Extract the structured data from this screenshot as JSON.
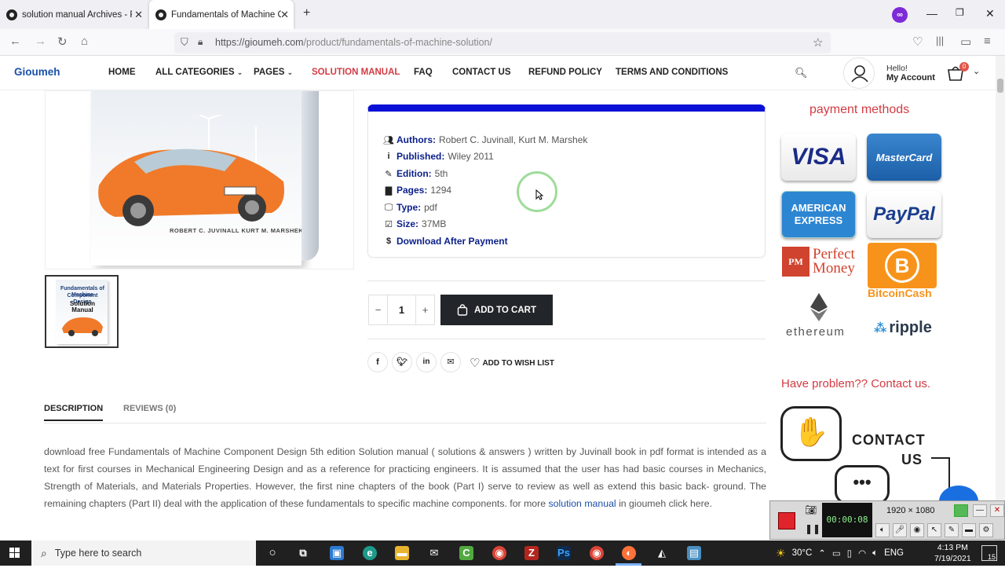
{
  "browser": {
    "tabs": [
      {
        "label": "solution manual Archives - Page",
        "active": false
      },
      {
        "label": "Fundamentals of Machine Comp",
        "active": true
      }
    ],
    "url_host": "https://gioumeh.com",
    "url_path": "/product/fundamentals-of-machine-solution/"
  },
  "site": {
    "logo": "Gioumeh",
    "menu": [
      "HOME",
      "ALL CATEGORIES",
      "PAGES",
      "SOLUTION MANUAL",
      "FAQ",
      "CONTACT US",
      "REFUND POLICY",
      "TERMS AND CONDITIONS"
    ],
    "active_menu": "SOLUTION MANUAL",
    "account_hello": "Hello!",
    "account_label": "My Account",
    "cart_count": "0"
  },
  "product": {
    "cover_authors": "ROBERT C. JUVINALL   KURT M. MARSHEK",
    "thumb_title_1": "Fundamentals of Machine",
    "thumb_title_2": "Component Design",
    "thumb_title_3": "Solution Manual",
    "info": [
      {
        "icon": "users-icon",
        "key": "Authors:",
        "value": "Robert C. Juvinall, Kurt M. Marshek"
      },
      {
        "icon": "info-icon",
        "key": "Published:",
        "value": "Wiley 2011"
      },
      {
        "icon": "pencil-icon",
        "key": "Edition:",
        "value": "5th"
      },
      {
        "icon": "file-icon",
        "key": "Pages:",
        "value": "1294"
      },
      {
        "icon": "monitor-icon",
        "key": "Type:",
        "value": "pdf"
      },
      {
        "icon": "checkbox-icon",
        "key": "Size:",
        "value": "37MB"
      },
      {
        "icon": "dollar-icon",
        "key": "Download After Payment",
        "value": ""
      }
    ],
    "quantity": "1",
    "add_to_cart": "ADD TO CART",
    "wishlist": "ADD TO WISH LIST",
    "tabs": {
      "description": "DESCRIPTION",
      "reviews": "REVIEWS (0)"
    },
    "description_before": "download free Fundamentals of Machine Component Design 5th edition Solution manual ( solutions & answers ) written by Juvinall book in pdf format is intended as a text for first courses in Mechanical Engineering Design and as a reference for practicing engineers. It is assumed that the user has had basic courses in Mechanics, Strength of Materials, and Materials Properties. However, the first nine chapters of the book (Part I) serve to review as well as extend this basic back- ground. The remaining chapters (Part II) deal with the application of these fundamentals to specific machine components. for more ",
    "description_link": "solution manual",
    "description_after": " in gioumeh click here."
  },
  "sidebar": {
    "payment_title": "payment methods",
    "visa": "VISA",
    "mastercard": "MasterCard",
    "amex_1": "AMERICAN",
    "amex_2": "EXPRESS",
    "paypal": "PayPal",
    "pm_box": "PM",
    "pm_1": "Perfect",
    "pm_2": "Money",
    "btc_symbol": "B",
    "btc": "BitcoinCash",
    "eth": "ethereum",
    "ripple": "ripple",
    "problem": "Have problem?? Contact us.",
    "contact_1": "CONTACT",
    "contact_2": "US"
  },
  "recorder": {
    "timer": "00:00:08",
    "resolution": "1920 × 1080"
  },
  "taskbar": {
    "search_placeholder": "Type here to search",
    "weather": "30°C",
    "language": "ENG",
    "time": "4:13 PM",
    "date": "7/19/2021",
    "notifications": "15"
  }
}
